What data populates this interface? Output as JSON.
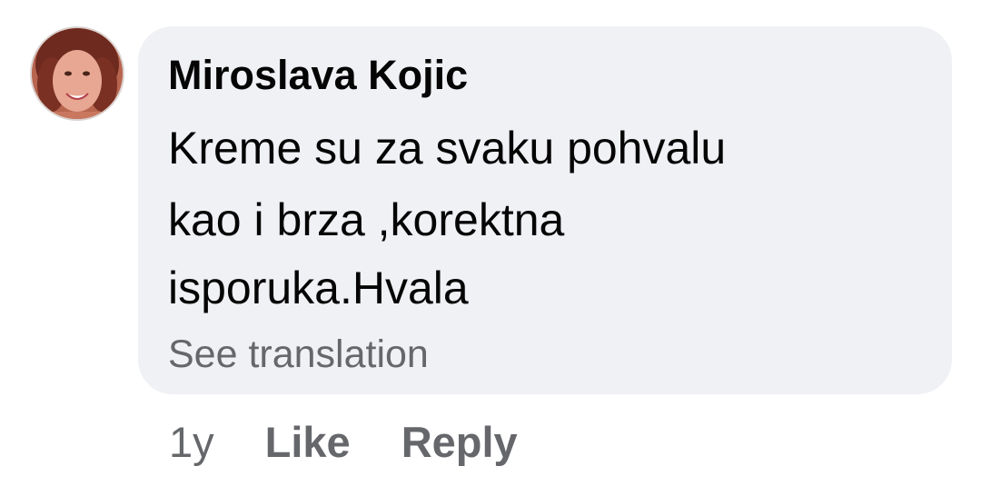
{
  "comment": {
    "author": "Miroslava Kojic",
    "lines": [
      "Kreme su za svaku pohvalu",
      "kao i brza ,korektna",
      "isporuka.Hvala"
    ],
    "see_translation": "See translation",
    "timestamp": "1y",
    "like_label": "Like",
    "reply_label": "Reply"
  },
  "colors": {
    "bubble_bg": "#f0f1f5",
    "text_primary": "#050505",
    "text_secondary": "#65676b"
  }
}
